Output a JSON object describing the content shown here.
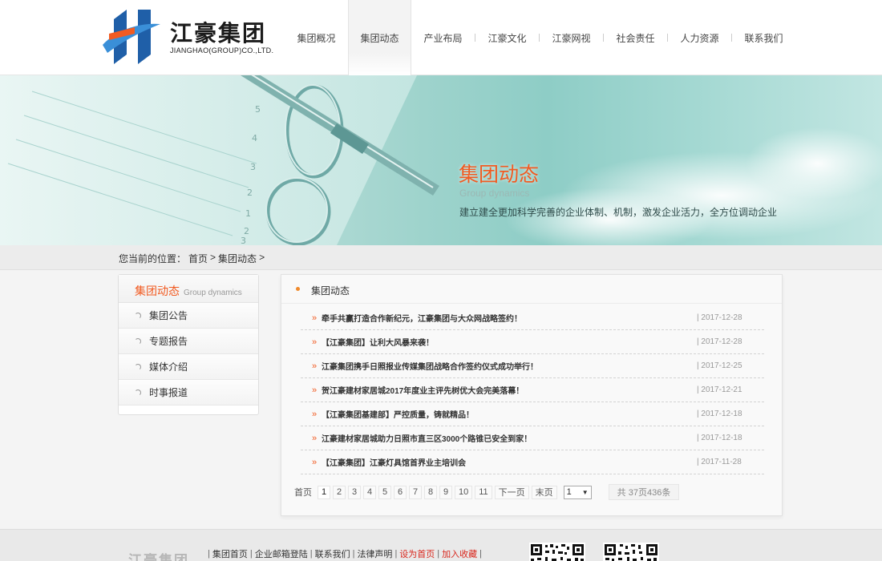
{
  "header": {
    "logo_cn": "江豪集团",
    "logo_en": "JIANGHAO(GROUP)CO.,LTD.",
    "nav": [
      {
        "label": "集团概况",
        "active": false
      },
      {
        "label": "集团动态",
        "active": true
      },
      {
        "label": "产业布局",
        "active": false
      },
      {
        "label": "江豪文化",
        "active": false
      },
      {
        "label": "江豪网视",
        "active": false
      },
      {
        "label": "社会责任",
        "active": false
      },
      {
        "label": "人力资源",
        "active": false
      },
      {
        "label": "联系我们",
        "active": false
      }
    ]
  },
  "banner": {
    "title": "集团动态",
    "subtitle": "Group dynamics",
    "desc": "建立建全更加科学完善的企业体制、机制，激发企业活力，全方位调动企业",
    "ring_labels": [
      "5",
      "4",
      "3",
      "2",
      "1",
      "2",
      "3"
    ]
  },
  "breadcrumb": {
    "prefix": "您当前的位置：",
    "home": "首页",
    "sep": ">",
    "current": "集团动态",
    "tail": ">"
  },
  "sidebar": {
    "title_cn": "集团动态",
    "title_en": "Group dynamics",
    "items": [
      "集团公告",
      "专题报告",
      "媒体介绍",
      "时事报道"
    ]
  },
  "main": {
    "title": "集团动态",
    "bullet": "»",
    "news": [
      {
        "title": "牵手共赢打造合作新纪元，江豪集团与大众网战略签约！",
        "date": "| 2017-12-28"
      },
      {
        "title": "【江豪集团】让利大风暴来袭！",
        "date": "| 2017-12-28"
      },
      {
        "title": "江豪集团携手日照报业传媒集团战略合作签约仪式成功举行！",
        "date": "| 2017-12-25"
      },
      {
        "title": "贺江豪建材家居城2017年度业主评先树优大会完美落幕！",
        "date": "| 2017-12-21"
      },
      {
        "title": "【江豪集团基建部】严控质量，铸就精品！",
        "date": "| 2017-12-18"
      },
      {
        "title": "江豪建材家居城助力日照市直三区3000个路锥已安全到家！",
        "date": "| 2017-12-18"
      },
      {
        "title": "【江豪集团】江豪灯具馆首界业主培训会",
        "date": "| 2017-11-28"
      }
    ],
    "pager": {
      "first": "首页",
      "pages": [
        "1",
        "2",
        "3",
        "4",
        "5",
        "6",
        "7",
        "8",
        "9",
        "10",
        "11"
      ],
      "current": "1",
      "next": "下一页",
      "last": "末页",
      "select_value": "1",
      "dropdown_glyph": "▼",
      "total": "共 37页436条"
    }
  },
  "footer": {
    "logo": "江豪集团",
    "links": [
      {
        "label": "集团首页",
        "red": false
      },
      {
        "label": "企业邮箱登陆",
        "red": false
      },
      {
        "label": "联系我们",
        "red": false
      },
      {
        "label": "法律声明",
        "red": false
      },
      {
        "label": "设为首页",
        "red": true
      },
      {
        "label": "加入收藏",
        "red": true
      }
    ],
    "separator": "|"
  },
  "colors": {
    "accent": "#f15b22",
    "logo_blue": "#1f5fa8",
    "link_red": "#d9261c"
  }
}
